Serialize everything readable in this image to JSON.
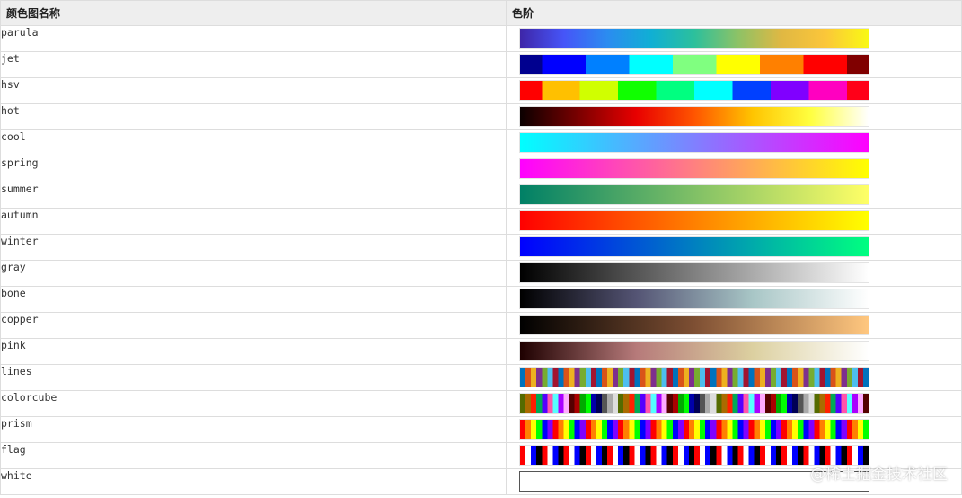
{
  "table": {
    "header_name": "颜色图名称",
    "header_scale": "色阶"
  },
  "rows": [
    {
      "name": "parula",
      "colors": [
        "#3e26a8",
        "#4655f8",
        "#2b8cf0",
        "#10afd4",
        "#2cc09c",
        "#8dc266",
        "#e0b843",
        "#fbc63a",
        "#f9f914"
      ]
    },
    {
      "name": "jet",
      "colors": [
        "#00008f",
        "#0000ff",
        "#0080ff",
        "#00ffff",
        "#80ff80",
        "#ffff00",
        "#ff8000",
        "#ff0000",
        "#800000"
      ]
    },
    {
      "name": "hsv",
      "colors": [
        "#ff0000",
        "#ffc000",
        "#d0ff00",
        "#10ff00",
        "#00ff80",
        "#00ffff",
        "#0040ff",
        "#8000ff",
        "#ff00c0",
        "#ff0018"
      ]
    },
    {
      "name": "hot",
      "colors": [
        "#0b0000",
        "#7a0000",
        "#e80000",
        "#ff5500",
        "#ffc400",
        "#ffff40",
        "#ffffff"
      ]
    },
    {
      "name": "cool",
      "colors": [
        "#00ffff",
        "#8080ff",
        "#ff00ff"
      ]
    },
    {
      "name": "spring",
      "colors": [
        "#ff00ff",
        "#ff8080",
        "#ffff00"
      ]
    },
    {
      "name": "summer",
      "colors": [
        "#008066",
        "#80c066",
        "#ffff66"
      ]
    },
    {
      "name": "autumn",
      "colors": [
        "#ff0000",
        "#ff8000",
        "#ffff00"
      ]
    },
    {
      "name": "winter",
      "colors": [
        "#0000ff",
        "#0080c0",
        "#00ff80"
      ]
    },
    {
      "name": "gray",
      "colors": [
        "#000000",
        "#808080",
        "#ffffff"
      ]
    },
    {
      "name": "bone",
      "colors": [
        "#000000",
        "#545474",
        "#a8c6c6",
        "#ffffff"
      ]
    },
    {
      "name": "copper",
      "colors": [
        "#000000",
        "#7e4f33",
        "#ffc77f"
      ]
    },
    {
      "name": "pink",
      "colors": [
        "#1e0000",
        "#b67a7a",
        "#dcd0a0",
        "#ffffff"
      ]
    },
    {
      "name": "lines",
      "colors": [
        "#0072bd",
        "#d95319",
        "#edb120",
        "#7e2f8e",
        "#77ac30",
        "#4dbeee",
        "#a2142f"
      ]
    },
    {
      "name": "colorcube",
      "colors": [
        "#556b00",
        "#aa6b00",
        "#ff2000",
        "#00aa55",
        "#5500ff",
        "#ff55aa",
        "#55ffff",
        "#aa00ff",
        "#ffaaff",
        "#550000",
        "#aa0000",
        "#00aa00",
        "#00ff00",
        "#0000aa",
        "#000055",
        "#555555",
        "#aaaaaa",
        "#dddddd"
      ]
    },
    {
      "name": "prism",
      "colors": [
        "#ff0000",
        "#ff8000",
        "#ffff00",
        "#00ff00",
        "#0000ff",
        "#8000ff"
      ]
    },
    {
      "name": "flag",
      "colors": [
        "#ff0000",
        "#ffffff",
        "#0000ff",
        "#000000"
      ]
    },
    {
      "name": "white",
      "colors": [
        "#ffffff"
      ]
    }
  ],
  "watermark": "@稀土掘金技术社区"
}
